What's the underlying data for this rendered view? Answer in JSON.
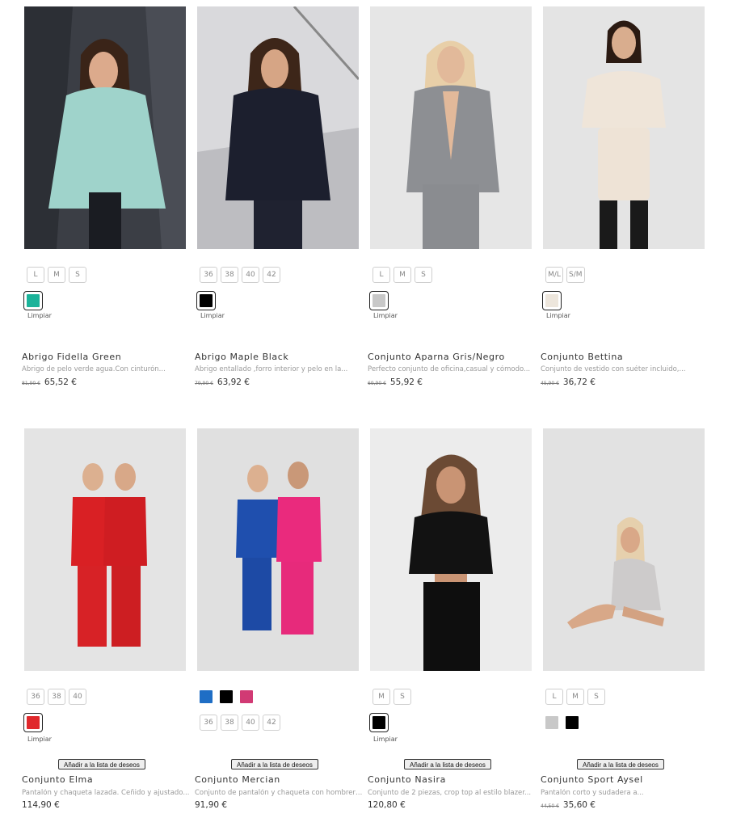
{
  "products": [
    {
      "name": "Abrigo Fidella Green",
      "description": "Abrigo de pelo verde agua.Con cinturón...",
      "old_price": "81,90 €",
      "price": "65,52 €",
      "sizes": [
        "L",
        "M",
        "S"
      ],
      "colors": [
        "#1bb39a"
      ],
      "clear_label": "Limpiar",
      "wishlist_label": ""
    },
    {
      "name": "Abrigo Maple Black",
      "description": "Abrigo entallado ,forro interior y pelo en la...",
      "old_price": "79,90 €",
      "price": "63,92 €",
      "sizes": [
        "36",
        "38",
        "40",
        "42"
      ],
      "colors": [
        "#000000"
      ],
      "clear_label": "Limpiar",
      "wishlist_label": ""
    },
    {
      "name": "Conjunto Aparna Gris/Negro",
      "description": "Perfecto conjunto de oficina,casual y cómodo...",
      "old_price": "69,90 €",
      "price": "55,92 €",
      "sizes": [
        "L",
        "M",
        "S"
      ],
      "colors": [
        "#c8c8c8"
      ],
      "clear_label": "Limpiar",
      "wishlist_label": ""
    },
    {
      "name": "Conjunto Bettina",
      "description": "Conjunto de vestido con suéter incluido,...",
      "old_price": "45,90 €",
      "price": "36,72 €",
      "sizes": [
        "M/L",
        "S/M"
      ],
      "colors": [
        "#ede6dc"
      ],
      "clear_label": "Limpiar",
      "wishlist_label": ""
    },
    {
      "name": "Conjunto Elma",
      "description": "Pantalón y chaqueta lazada. Ceñido y ajustado...",
      "old_price": "",
      "price": "114,90 €",
      "sizes": [
        "36",
        "38",
        "40"
      ],
      "colors": [
        "#e0282c"
      ],
      "clear_label": "Limpiar",
      "wishlist_label": "Añadir a la lista de deseos"
    },
    {
      "name": "Conjunto Mercian",
      "description": "Conjunto de pantalón y chaqueta con hombreras...",
      "old_price": "",
      "price": "91,90 €",
      "sizes": [
        "36",
        "38",
        "40",
        "42"
      ],
      "colors": [
        "#1f6ec5",
        "#000000",
        "#d13a74"
      ],
      "clear_label": "",
      "wishlist_label": "Añadir a la lista de deseos"
    },
    {
      "name": "Conjunto Nasira",
      "description": "Conjunto de 2 piezas, crop top al estilo blazer...",
      "old_price": "",
      "price": "120,80 €",
      "sizes": [
        "M",
        "S"
      ],
      "colors": [
        "#000000"
      ],
      "clear_label": "Limpiar",
      "wishlist_label": "Añadir a la lista de deseos"
    },
    {
      "name": "Conjunto Sport Aysel",
      "description": "Pantalón corto y sudadera a...",
      "old_price": "44,50 €",
      "price": "35,60 €",
      "sizes": [
        "L",
        "M",
        "S"
      ],
      "colors": [
        "#c8c8c8",
        "#000000"
      ],
      "clear_label": "",
      "wishlist_label": "Añadir a la lista de deseos"
    }
  ]
}
